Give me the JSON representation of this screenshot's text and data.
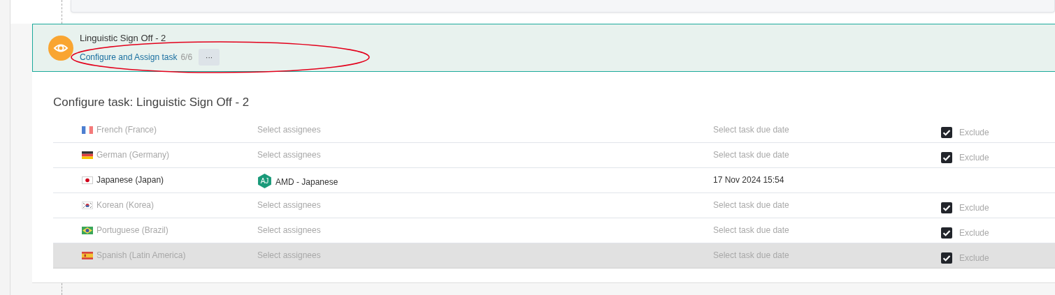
{
  "step": {
    "title": "Linguistic Sign Off - 2",
    "link": "Configure and Assign task",
    "count": "6/6",
    "more": "···"
  },
  "panel": {
    "heading": "Configure task: Linguistic Sign Off - 2",
    "rows": [
      {
        "kind": "fr",
        "language": "French (France)",
        "assignee": "Select assignees",
        "due": "Select task due date",
        "excluded": true,
        "exclude_label": "Exclude",
        "selected": false
      },
      {
        "kind": "de",
        "language": "German (Germany)",
        "assignee": "Select assignees",
        "due": "Select task due date",
        "excluded": true,
        "exclude_label": "Exclude",
        "selected": false
      },
      {
        "kind": "jp",
        "language": "Japanese (Japan)",
        "avatar": "AJ",
        "assignee": "AMD - Japanese",
        "due": "17 Nov 2024 15:54",
        "excluded": false,
        "selected": false
      },
      {
        "kind": "kr",
        "language": "Korean (Korea)",
        "assignee": "Select assignees",
        "due": "Select task due date",
        "excluded": true,
        "exclude_label": "Exclude",
        "selected": false
      },
      {
        "kind": "br",
        "language": "Portuguese (Brazil)",
        "assignee": "Select assignees",
        "due": "Select task due date",
        "excluded": true,
        "exclude_label": "Exclude",
        "selected": false
      },
      {
        "kind": "es",
        "language": "Spanish (Latin America)",
        "assignee": "Select assignees",
        "due": "Select task due date",
        "excluded": true,
        "exclude_label": "Exclude",
        "selected": true
      }
    ]
  }
}
